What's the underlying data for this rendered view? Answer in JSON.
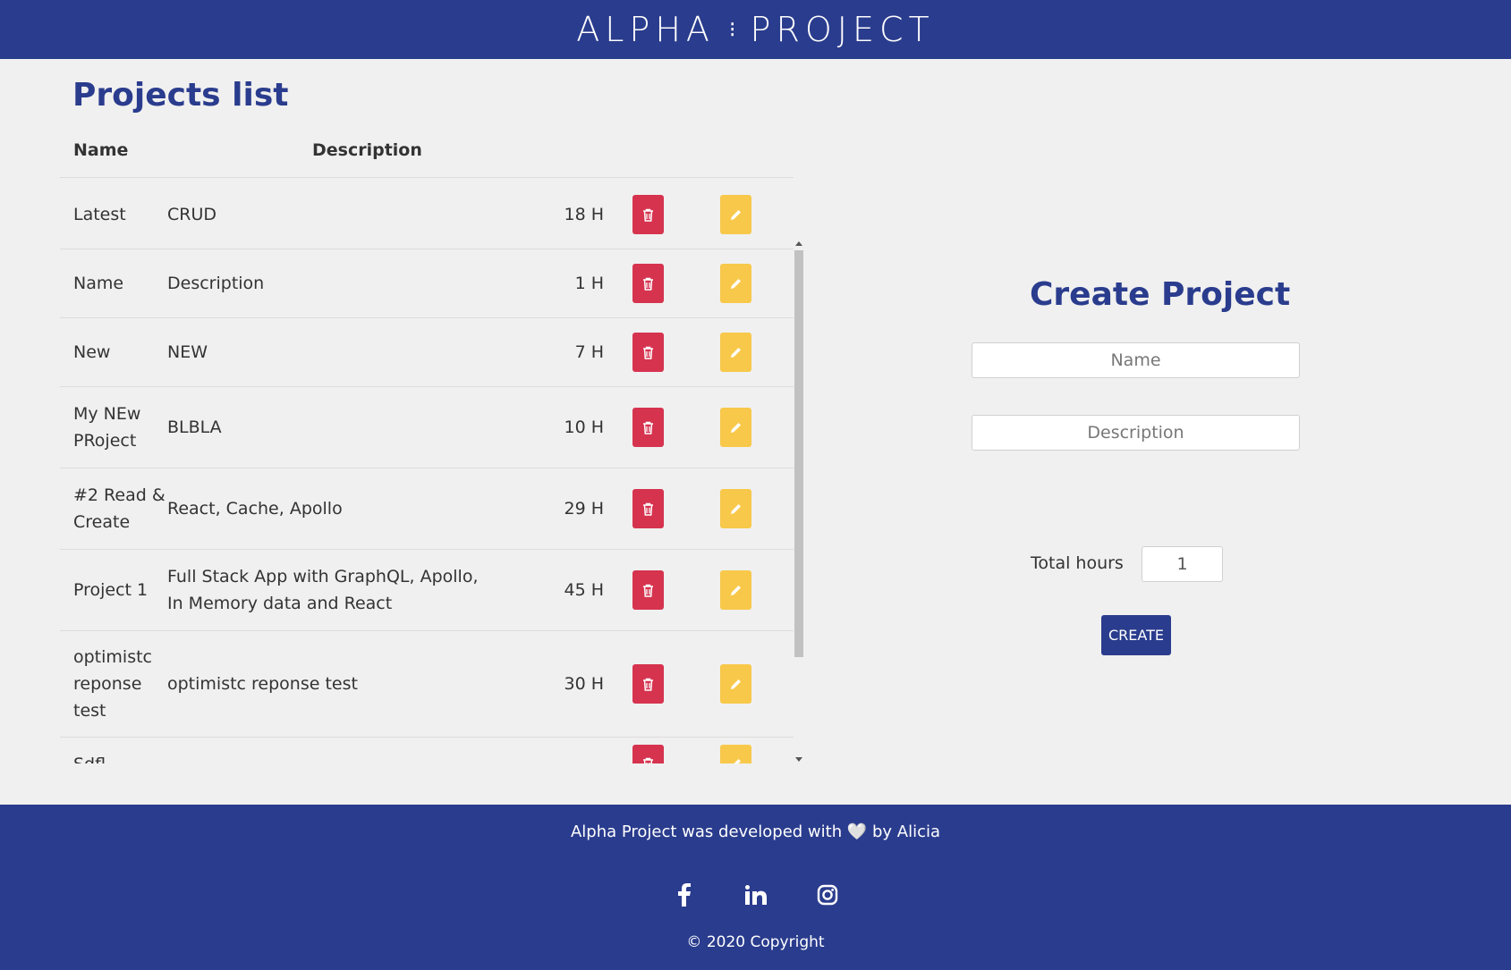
{
  "header": {
    "logo_left": "ALPHA",
    "logo_sep": "⁝",
    "logo_right": "PROJECT"
  },
  "list": {
    "title": "Projects list",
    "headers": {
      "name": "Name",
      "description": "Description"
    },
    "rows": [
      {
        "name": "Latest",
        "description": "CRUD",
        "hours": "18 H"
      },
      {
        "name": "Name",
        "description": "Description",
        "hours": "1 H"
      },
      {
        "name": "New",
        "description": "NEW",
        "hours": "7 H"
      },
      {
        "name": "My NEw PRoject",
        "description": "BLBLA",
        "hours": "10 H"
      },
      {
        "name": "#2 Read & Create",
        "description": "React, Cache, Apollo",
        "hours": "29 H"
      },
      {
        "name": "Project 1",
        "description": "Full Stack App with GraphQL, Apollo, In Memory data and React",
        "hours": "45 H"
      },
      {
        "name": "optimistc reponse test",
        "description": "optimistc reponse test",
        "hours": "30 H"
      },
      {
        "name": "Sdfl",
        "description": "",
        "hours": ""
      }
    ]
  },
  "create": {
    "title": "Create Project",
    "name_placeholder": "Name",
    "description_placeholder": "Description",
    "hours_label": "Total hours",
    "hours_value": "1",
    "button_label": "CREATE"
  },
  "footer": {
    "text": "Alpha Project was developed with 🤍 by Alicia",
    "copyright": "© 2020 Copyright",
    "socials": [
      "facebook-icon",
      "linkedin-icon",
      "instagram-icon"
    ]
  },
  "colors": {
    "primary": "#2a3c8d",
    "delete": "#d6334f",
    "edit": "#f8c84a",
    "background": "#f0f0f0"
  }
}
